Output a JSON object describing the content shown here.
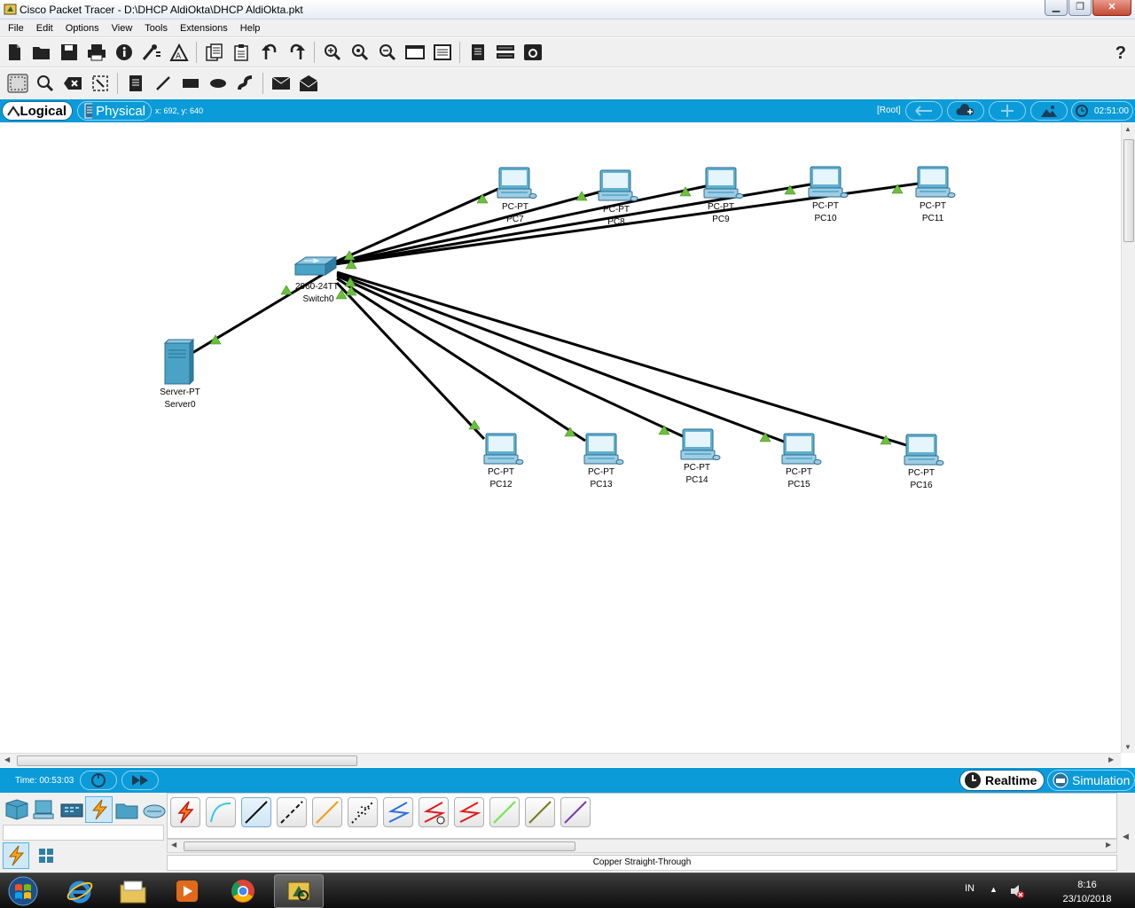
{
  "window": {
    "title": "Cisco Packet Tracer - D:\\DHCP AldiOkta\\DHCP AldiOkta.pkt"
  },
  "menu": [
    "File",
    "Edit",
    "Options",
    "View",
    "Tools",
    "Extensions",
    "Help"
  ],
  "main_toolbar": [
    "new-icon",
    "open-icon",
    "save-icon",
    "print-icon",
    "info-icon",
    "network-wizard-icon",
    "activity-wizard-icon",
    "copy-icon",
    "paste-icon",
    "undo-icon",
    "redo-icon",
    "zoom-in-icon",
    "zoom-reset-icon",
    "zoom-out-icon",
    "drawing-palette-icon",
    "custom-device-icon",
    "viewport-icon",
    "cluster-icon",
    "screenshot-icon"
  ],
  "secondary_toolbar": [
    "select-icon",
    "inspect-icon",
    "delete-icon",
    "resize-icon",
    "note-icon",
    "line-icon",
    "rectangle-icon",
    "ellipse-icon",
    "freeform-icon",
    "simple-pdu-icon",
    "complex-pdu-icon"
  ],
  "workspace": {
    "logical_label": "Logical",
    "physical_label": "Physical",
    "coordinates": "x: 692, y: 640",
    "root_label": "[Root]",
    "clock": "02:51:00"
  },
  "topology": {
    "switch": {
      "model": "2960-24TT",
      "name": "Switch0"
    },
    "server": {
      "model": "Server-PT",
      "name": "Server0"
    },
    "pcs": [
      {
        "model": "PC-PT",
        "name": "PC7"
      },
      {
        "model": "PC-PT",
        "name": "PC8"
      },
      {
        "model": "PC-PT",
        "name": "PC9"
      },
      {
        "model": "PC-PT",
        "name": "PC10"
      },
      {
        "model": "PC-PT",
        "name": "PC11"
      },
      {
        "model": "PC-PT",
        "name": "PC12"
      },
      {
        "model": "PC-PT",
        "name": "PC13"
      },
      {
        "model": "PC-PT",
        "name": "PC14"
      },
      {
        "model": "PC-PT",
        "name": "PC15"
      },
      {
        "model": "PC-PT",
        "name": "PC16"
      }
    ],
    "link_status_color": "#6cbf3c",
    "link_color": "#000000"
  },
  "bottom": {
    "time": "Time: 00:53:03",
    "realtime_label": "Realtime",
    "simulation_label": "Simulation"
  },
  "device_panel": {
    "selected_cable": "Copper Straight-Through",
    "categories": [
      "network-devices-icon",
      "end-devices-icon",
      "components-icon",
      "connections-icon",
      "miscellaneous-icon",
      "multiuser-icon"
    ],
    "cables": [
      "automatic-cable-icon",
      "console-cable-icon",
      "copper-straight-through-icon",
      "copper-cross-over-icon",
      "fiber-icon",
      "phone-cable-icon",
      "coaxial-cable-icon",
      "serial-dce-icon",
      "serial-dte-icon",
      "octal-cable-icon",
      "iot-cable-icon",
      "usb-cable-icon"
    ]
  },
  "taskbar": {
    "language": "IN",
    "time": "8:16",
    "date": "23/10/2018"
  },
  "colors": {
    "accent": "#0b9bd8",
    "device": "#4aa3c6"
  }
}
